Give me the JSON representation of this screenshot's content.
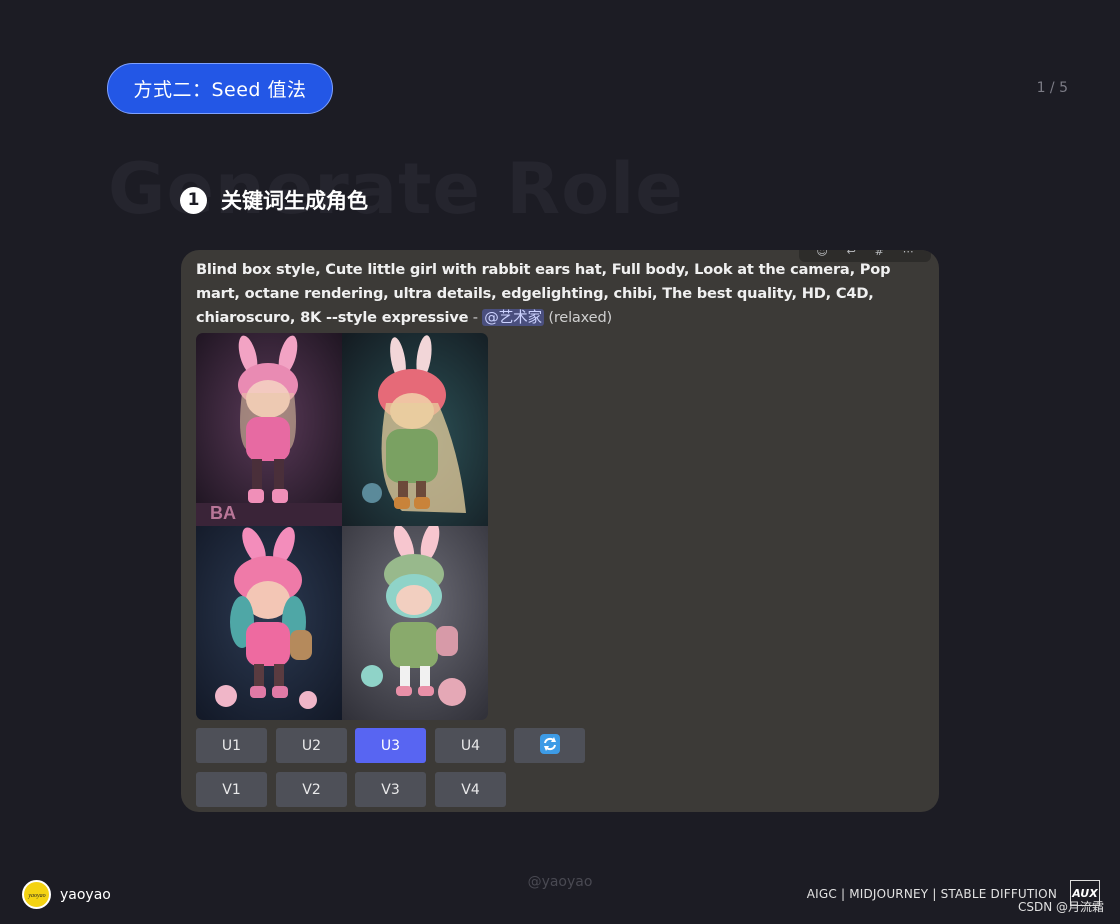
{
  "header": {
    "pill_label": "方式二：Seed 值法",
    "page_number": "1 / 5",
    "bg_title": "Generate Role",
    "step_number": "1",
    "step_label": "关键词生成角色"
  },
  "message": {
    "prompt_bold_1": "Blind box style, Cute little girl with rabbit ears hat, Full body, Look at the camera, Pop mart, octane rendering, ultra details, edgelighting, chibi, The best quality, HD, C4D, chiaroscuro, 8K --style expressive",
    "separator": " - ",
    "mention": "@艺术家",
    "status": "(relaxed)",
    "image_grid": [
      {
        "name": "image-1",
        "alt": ""
      },
      {
        "name": "image-2",
        "alt": ""
      },
      {
        "name": "image-3",
        "alt": ""
      },
      {
        "name": "image-4",
        "alt": ""
      }
    ],
    "upscale_buttons": [
      "U1",
      "U2",
      "U3",
      "U4"
    ],
    "variation_buttons": [
      "V1",
      "V2",
      "V3",
      "V4"
    ],
    "active_button": "U3",
    "reroll_icon": "refresh-icon",
    "colors": {
      "active": "#5865f2",
      "button": "#4e5058",
      "card": "#3c3a37"
    }
  },
  "footer": {
    "watermark": "@yaoyao",
    "author_name": "yaoyao",
    "avatar_text": "yaoyao",
    "tags": "AIGC | MIDJOURNEY | STABLE DIFFUTION",
    "logo": "AUX",
    "csdn": "CSDN @月流霜"
  }
}
